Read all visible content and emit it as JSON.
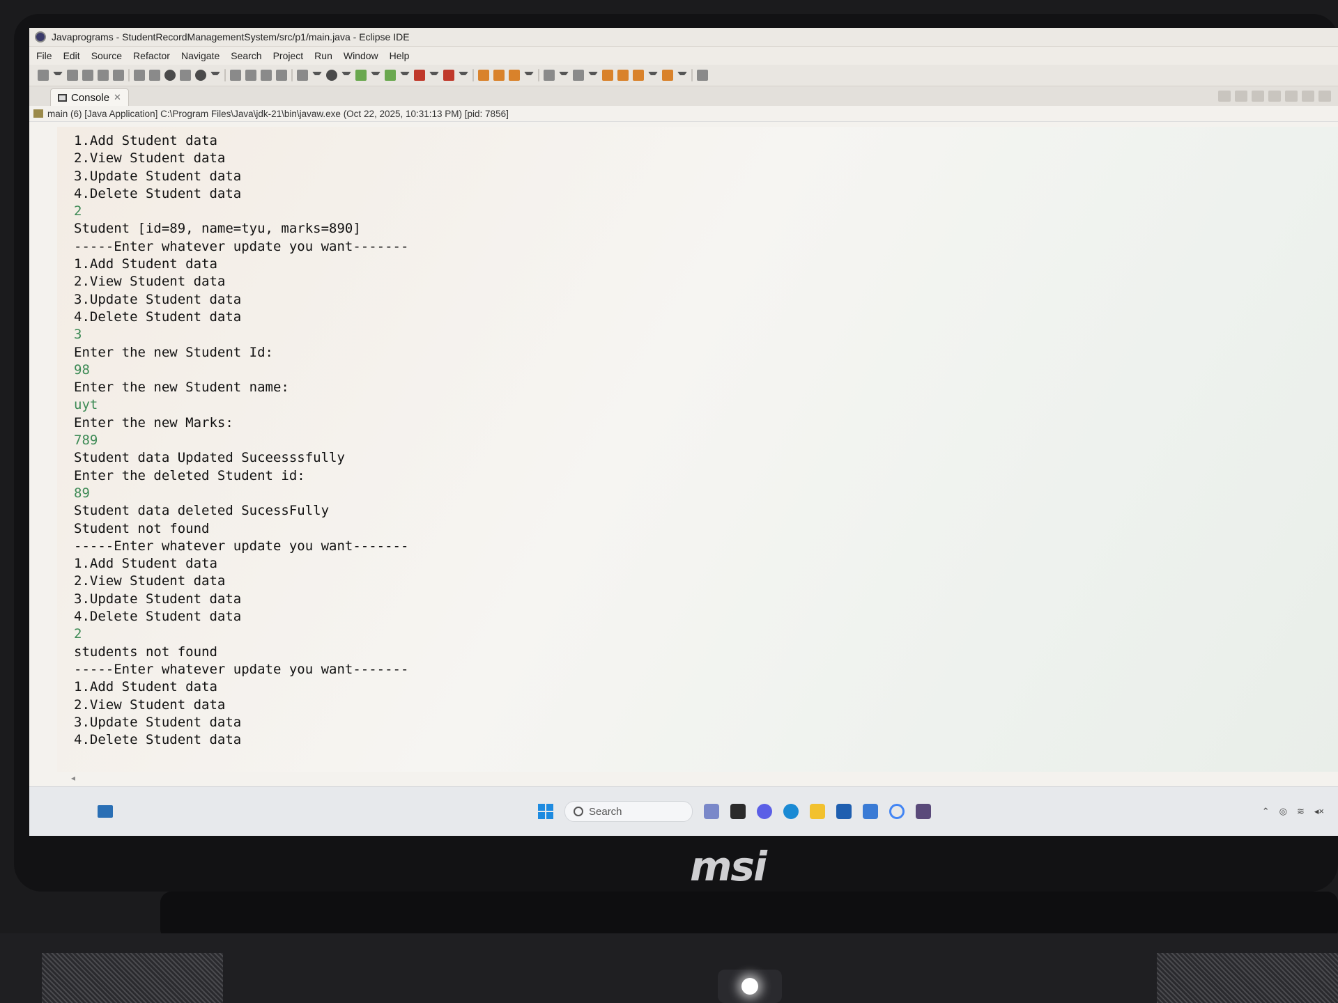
{
  "window": {
    "title": "Javaprograms - StudentRecordManagementSystem/src/p1/main.java - Eclipse IDE"
  },
  "menu": [
    "File",
    "Edit",
    "Source",
    "Refactor",
    "Navigate",
    "Search",
    "Project",
    "Run",
    "Window",
    "Help"
  ],
  "console_tab": {
    "label": "Console",
    "close": "✕"
  },
  "launch": {
    "text": "main (6) [Java Application] C:\\Program Files\\Java\\jdk-21\\bin\\javaw.exe  (Oct 22, 2025, 10:31:13 PM) [pid: 7856]"
  },
  "console_lines": [
    {
      "text": "1.Add Student data",
      "type": "out"
    },
    {
      "text": "2.View Student data",
      "type": "out"
    },
    {
      "text": "3.Update Student data",
      "type": "out"
    },
    {
      "text": "4.Delete Student data",
      "type": "out"
    },
    {
      "text": "2",
      "type": "in"
    },
    {
      "text": "Student [id=89, name=tyu, marks=890]",
      "type": "out"
    },
    {
      "text": "-----Enter whatever update you want-------",
      "type": "out"
    },
    {
      "text": "1.Add Student data",
      "type": "out"
    },
    {
      "text": "2.View Student data",
      "type": "out"
    },
    {
      "text": "3.Update Student data",
      "type": "out"
    },
    {
      "text": "4.Delete Student data",
      "type": "out"
    },
    {
      "text": "3",
      "type": "in"
    },
    {
      "text": "Enter the new Student Id:",
      "type": "out"
    },
    {
      "text": "98",
      "type": "in"
    },
    {
      "text": "Enter the new Student name:",
      "type": "out"
    },
    {
      "text": "uyt",
      "type": "in"
    },
    {
      "text": "Enter the new Marks:",
      "type": "out"
    },
    {
      "text": "789",
      "type": "in"
    },
    {
      "text": "Student data Updated Suceesssfully",
      "type": "out"
    },
    {
      "text": "Enter the deleted Student id:",
      "type": "out"
    },
    {
      "text": "89",
      "type": "in"
    },
    {
      "text": "Student data deleted SucessFully",
      "type": "out"
    },
    {
      "text": "Student not found",
      "type": "out"
    },
    {
      "text": "-----Enter whatever update you want-------",
      "type": "out"
    },
    {
      "text": "1.Add Student data",
      "type": "out"
    },
    {
      "text": "2.View Student data",
      "type": "out"
    },
    {
      "text": "3.Update Student data",
      "type": "out"
    },
    {
      "text": "4.Delete Student data",
      "type": "out"
    },
    {
      "text": "2",
      "type": "in"
    },
    {
      "text": "students not found",
      "type": "out"
    },
    {
      "text": "-----Enter whatever update you want-------",
      "type": "out"
    },
    {
      "text": "1.Add Student data",
      "type": "out"
    },
    {
      "text": "2.View Student data",
      "type": "out"
    },
    {
      "text": "3.Update Student data",
      "type": "out"
    },
    {
      "text": "4.Delete Student data",
      "type": "out"
    }
  ],
  "colors": {
    "input_text": "#3d8a55",
    "output_text": "#111111"
  },
  "taskbar": {
    "search_placeholder": "Search"
  },
  "laptop": {
    "brand": "msi"
  }
}
